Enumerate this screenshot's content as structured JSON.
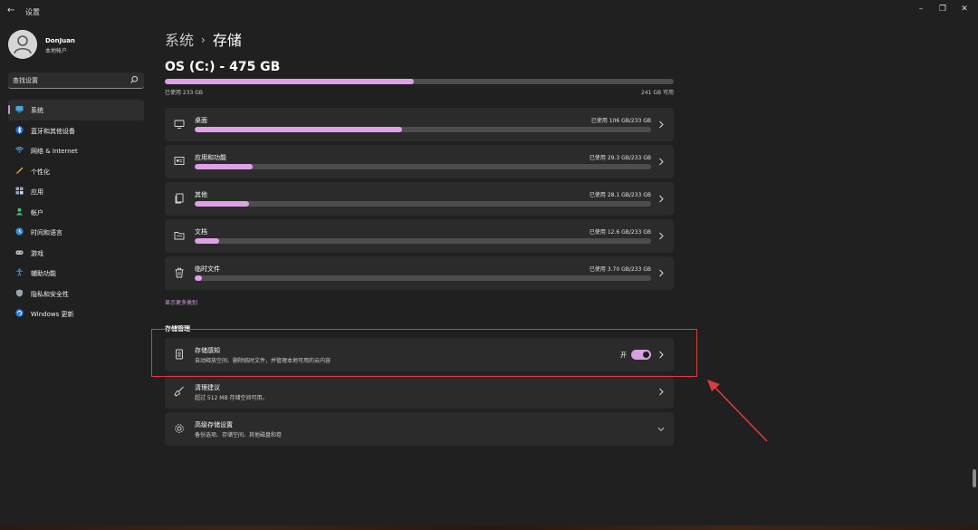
{
  "window": {
    "title": "设置",
    "back_icon": "back-arrow-icon",
    "controls": [
      "minimize-icon",
      "restore-icon",
      "close-icon"
    ]
  },
  "profile": {
    "name": "DonJuan",
    "account_type": "本地帐户"
  },
  "search": {
    "placeholder": "查找设置"
  },
  "sidebar": {
    "items": [
      {
        "label": "系统",
        "icon": "monitor-icon",
        "active": true
      },
      {
        "label": "蓝牙和其他设备",
        "icon": "bluetooth-icon"
      },
      {
        "label": "网络 & Internet",
        "icon": "wifi-icon"
      },
      {
        "label": "个性化",
        "icon": "brush-icon"
      },
      {
        "label": "应用",
        "icon": "apps-icon"
      },
      {
        "label": "帐户",
        "icon": "person-icon"
      },
      {
        "label": "时间和语言",
        "icon": "globe-clock-icon"
      },
      {
        "label": "游戏",
        "icon": "gamepad-icon"
      },
      {
        "label": "辅助功能",
        "icon": "accessibility-icon"
      },
      {
        "label": "隐私和安全性",
        "icon": "shield-icon"
      },
      {
        "label": "Windows 更新",
        "icon": "update-icon"
      }
    ]
  },
  "header": {
    "parent": "系统",
    "current": "存储"
  },
  "drive": {
    "title": "OS (C:) - 475 GB",
    "used_label": "已使用 233 GB",
    "free_label": "241 GB 可用",
    "used_fraction": 0.49
  },
  "categories": [
    {
      "name": "桌面",
      "size": "已使用 106 GB/233 GB",
      "fraction": 0.455,
      "icon": "desktop-icon"
    },
    {
      "name": "应用和功能",
      "size": "已使用 29.3 GB/233 GB",
      "fraction": 0.126,
      "icon": "apps-features-icon"
    },
    {
      "name": "其他",
      "size": "已使用 28.1 GB/233 GB",
      "fraction": 0.12,
      "icon": "other-files-icon"
    },
    {
      "name": "文档",
      "size": "已使用 12.6 GB/233 GB",
      "fraction": 0.054,
      "icon": "folder-icon"
    },
    {
      "name": "临时文件",
      "size": "已使用 3.70 GB/233 GB",
      "fraction": 0.016,
      "icon": "trash-icon"
    }
  ],
  "more_categories": "显示更多类别",
  "storage_management": {
    "title": "存储管理",
    "items": [
      {
        "title": "存储感知",
        "desc": "自动释放空间、删除临时文件，并管理本地可用的云内容",
        "icon": "storage-sense-icon",
        "toggle_label": "开",
        "toggle_on": true
      },
      {
        "title": "清理建议",
        "desc": "超过 512 MB 存储空间可用。",
        "icon": "broom-icon"
      },
      {
        "title": "高级存储设置",
        "desc": "备份选项、存储空间、其他磁盘和卷",
        "icon": "gear-icon"
      }
    ]
  },
  "colors": {
    "accent": "#e0a0e8",
    "bar_track": "#4d4d4d",
    "card_bg": "#2b2b2b",
    "window_bg": "#202020",
    "annotation": "#e03a3a"
  }
}
